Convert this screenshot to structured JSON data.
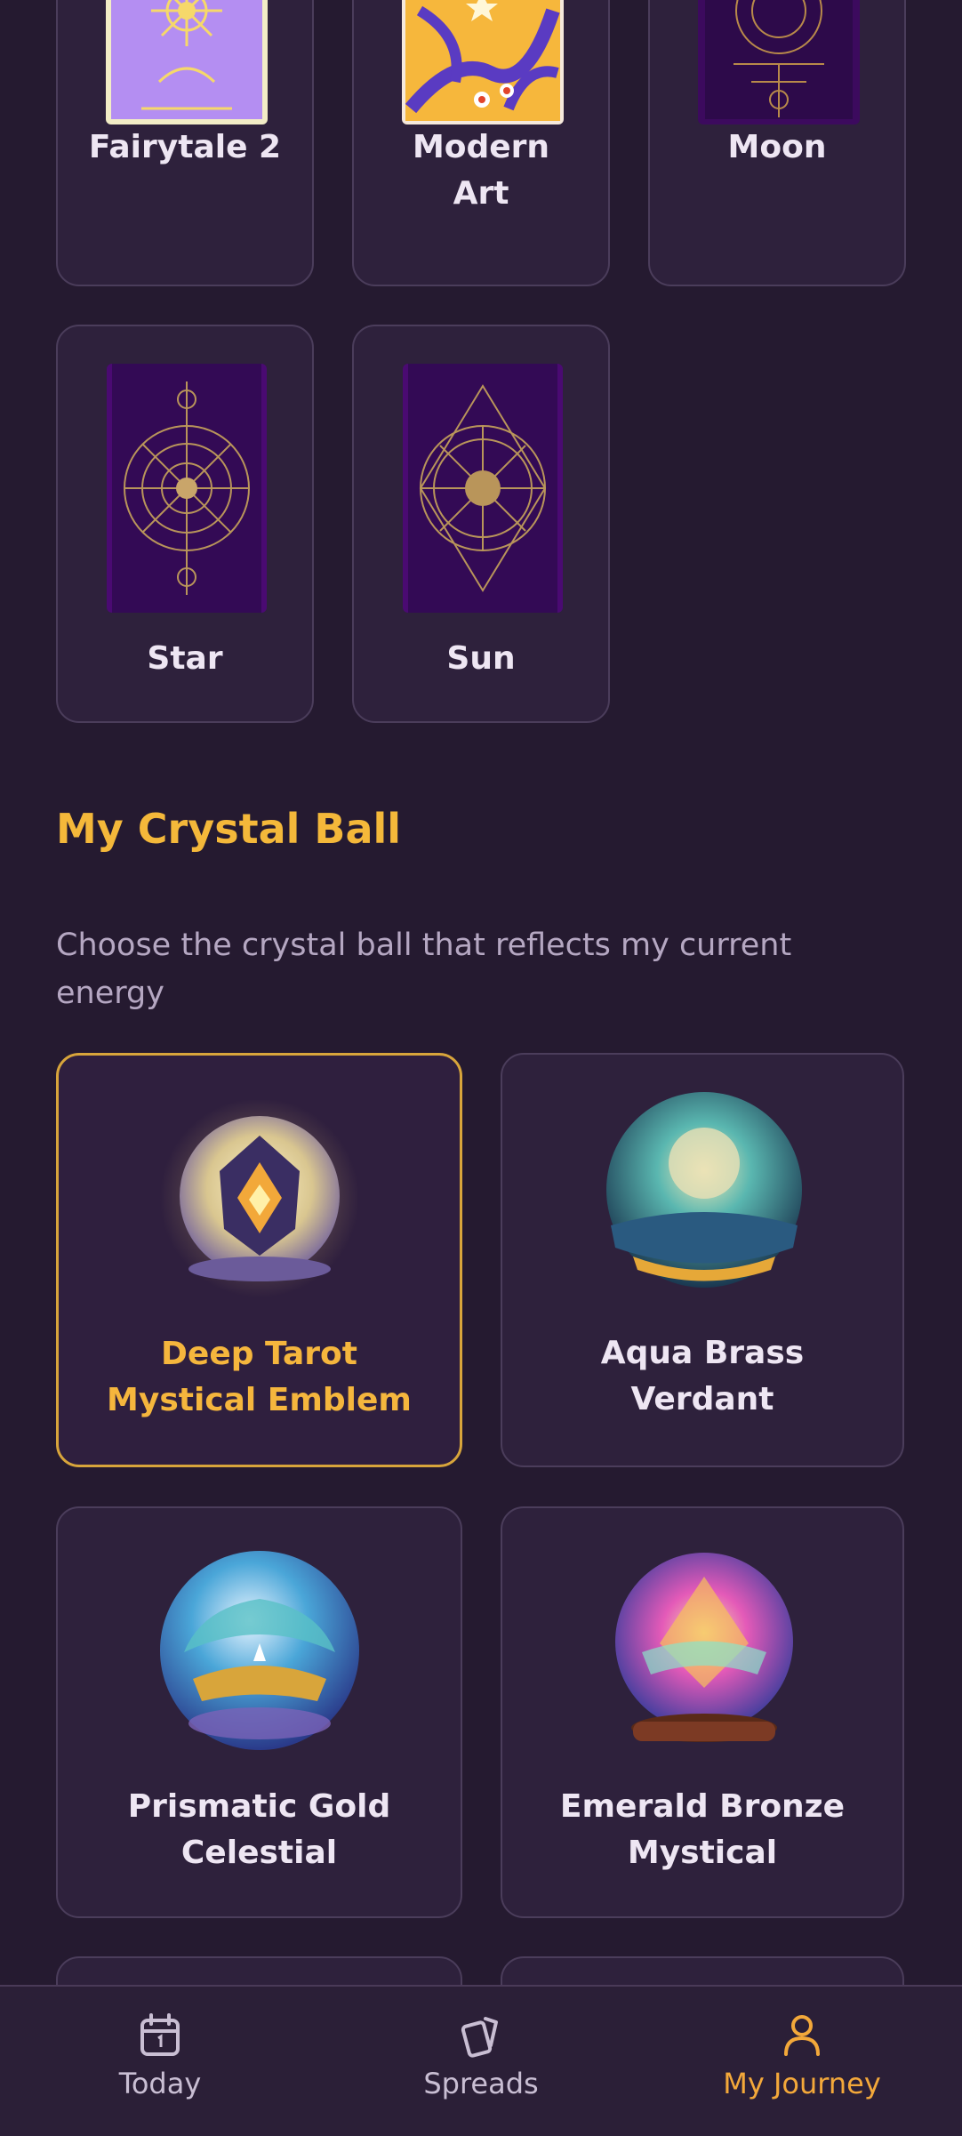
{
  "decks": [
    {
      "label": "Fairytale 2"
    },
    {
      "label_line1": "Modern",
      "label_line2": "Art"
    },
    {
      "label": "Moon"
    },
    {
      "label": "Star"
    },
    {
      "label": "Sun"
    }
  ],
  "crystal_section": {
    "title": "My Crystal Ball",
    "subtitle": "Choose the crystal ball that reflects my current energy"
  },
  "crystal_balls": [
    {
      "line1": "Deep Tarot",
      "line2": "Mystical Emblem",
      "selected": true
    },
    {
      "line1": "Aqua Brass",
      "line2": "Verdant",
      "selected": false
    },
    {
      "line1": "Prismatic Gold",
      "line2": "Celestial",
      "selected": false
    },
    {
      "line1": "Emerald Bronze",
      "line2": "Mystical",
      "selected": false
    }
  ],
  "bottom_nav": {
    "items": [
      {
        "label": "Today",
        "icon": "calendar-icon",
        "active": false
      },
      {
        "label": "Spreads",
        "icon": "cards-icon",
        "active": false
      },
      {
        "label": "My Journey",
        "icon": "user-icon",
        "active": true
      }
    ]
  },
  "colors": {
    "background": "#251a30",
    "card": "#2e213c",
    "accent": "#f4b83a",
    "selected_border": "#d8a53b"
  }
}
